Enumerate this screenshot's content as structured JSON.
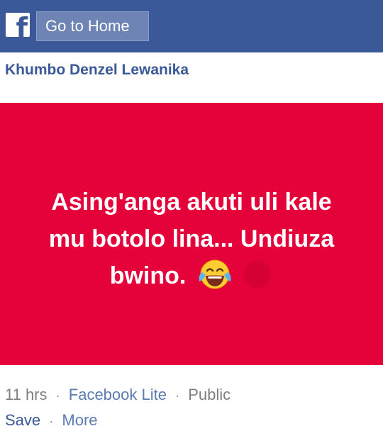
{
  "header": {
    "logo_icon": "facebook-f-icon",
    "home_button_label": "Go to Home",
    "bar_color": "#3b5998"
  },
  "post": {
    "author": "Khumbo  Denzel  Lewanika",
    "text_line1": "Asing'anga akuti uli kale",
    "text_line2": "mu botolo lina... Undiuza",
    "text_line3": "bwino.",
    "emoji_1": "face-with-tears-of-joy-icon",
    "emoji_2": "faded-emoji-icon",
    "background_color": "#e5013a"
  },
  "meta": {
    "time": "11 hrs",
    "source": "Facebook  Lite",
    "privacy": "Public",
    "separator": "·"
  },
  "actions": {
    "save_label": "Save",
    "more_label": "More",
    "separator": "·"
  }
}
